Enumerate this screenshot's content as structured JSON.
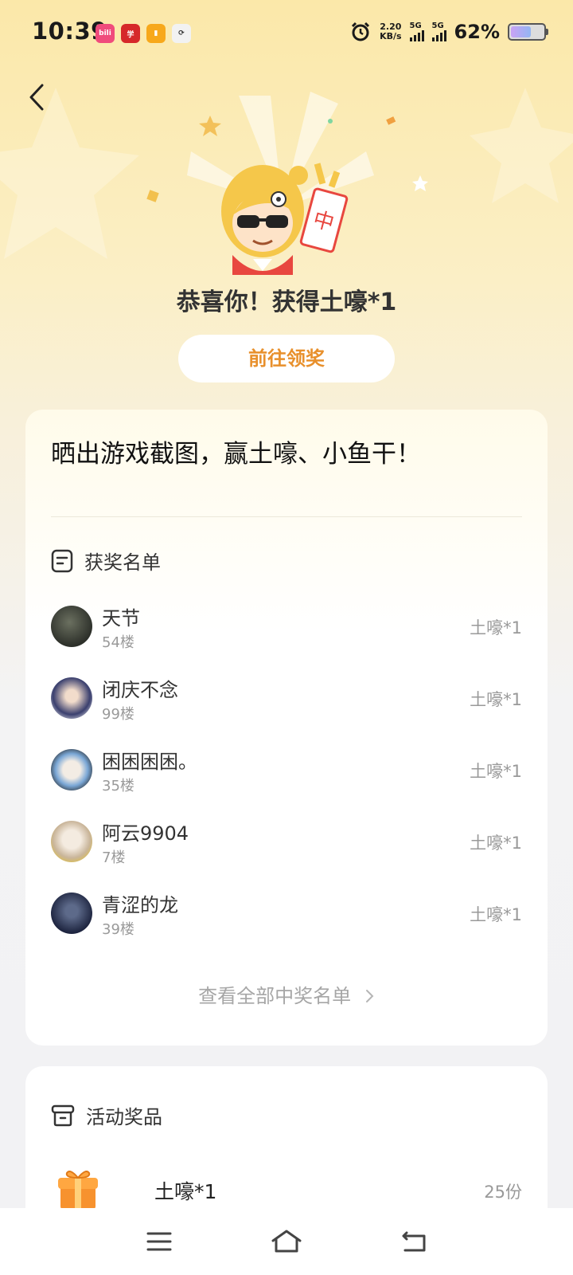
{
  "status_bar": {
    "time": "10:39",
    "net_speed_value": "2.20",
    "net_speed_unit": "KB/s",
    "signal_1": "5G",
    "signal_2": "5G",
    "battery": "62%",
    "battery_level": 0.62,
    "app_icons": [
      "bilibili-app-icon",
      "red-app-icon",
      "yellow-app-icon",
      "sync-app-icon"
    ]
  },
  "header": {
    "congrats": "恭喜你！获得土嚎*1",
    "claim_button": "前往领奖"
  },
  "activity": {
    "title": "晒出游戏截图，赢土嚎、小鱼干！"
  },
  "winners": {
    "heading": "获奖名单",
    "list": [
      {
        "name": "天节",
        "floor": "54楼",
        "prize": "土嚎*1"
      },
      {
        "name": "闭庆不念",
        "floor": "99楼",
        "prize": "土嚎*1"
      },
      {
        "name": "困困困困。",
        "floor": "35楼",
        "prize": "土嚎*1"
      },
      {
        "name": "阿云9904",
        "floor": "7楼",
        "prize": "土嚎*1"
      },
      {
        "name": "青涩的龙",
        "floor": "39楼",
        "prize": "土嚎*1"
      }
    ],
    "view_all": "查看全部中奖名单"
  },
  "prizes": {
    "heading": "活动奖品",
    "items": [
      {
        "name": "土嚎*1",
        "count": "25份"
      }
    ]
  },
  "colors": {
    "accent": "#e8902c",
    "background_top": "#fbe8a9"
  }
}
